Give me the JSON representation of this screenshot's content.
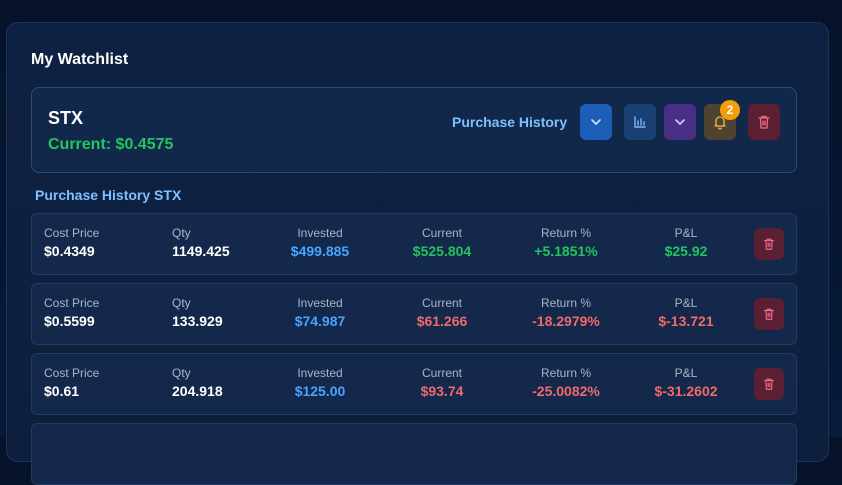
{
  "watchlist": {
    "title": "My Watchlist"
  },
  "stock": {
    "symbol": "STX",
    "current_label": "Current: $0.4575",
    "purchase_history_link": "Purchase History",
    "alert_count": "2"
  },
  "history": {
    "title": "Purchase History STX",
    "labels": {
      "cost": "Cost Price",
      "qty": "Qty",
      "invested": "Invested",
      "current": "Current",
      "return": "Return %",
      "pl": "P&L"
    },
    "rows": [
      {
        "cost": "$0.4349",
        "qty": "1149.425",
        "invested": "$499.885",
        "current": "$525.804",
        "return": "+5.1851%",
        "pl": "$25.92"
      },
      {
        "cost": "$0.5599",
        "qty": "133.929",
        "invested": "$74.987",
        "current": "$61.266",
        "return": "-18.2979%",
        "pl": "$-13.721"
      },
      {
        "cost": "$0.61",
        "qty": "204.918",
        "invested": "$125.00",
        "current": "$93.74",
        "return": "-25.0082%",
        "pl": "$-31.2602"
      }
    ]
  }
}
